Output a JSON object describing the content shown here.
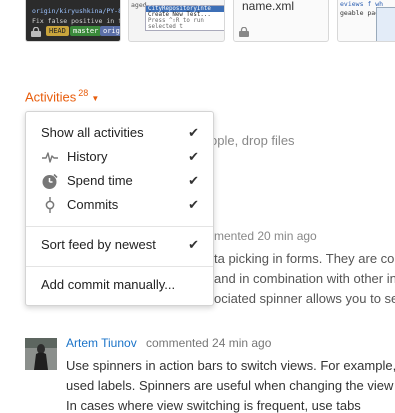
{
  "thumbnails": [
    {
      "lines": [
        "origin/kiryushkina/PY-8",
        "Fix false positive in format h"
      ],
      "branches": [
        "HEAD",
        "master",
        "origin"
      ]
    },
    {
      "lines": [
        "aged",
        "CityRepositoryInte",
        "Create New Test...",
        "Press ^⇧R to run selected t"
      ]
    },
    {
      "filename": "name.xml"
    },
    {
      "lines": [
        "eviews f wh",
        "geable page"
      ]
    }
  ],
  "activities": {
    "label": "Activities",
    "count": "28"
  },
  "menu": {
    "show_all": "Show all activities",
    "history": "History",
    "spend_time": "Spend time",
    "commits": "Commits",
    "sort": "Sort feed by newest",
    "add_commit": "Add commit manually...",
    "check_mark": "✔"
  },
  "background": {
    "drop_text": "ople, drop files",
    "event_meta": "mented 20 min ago",
    "line1": "ta picking in forms. They are co",
    "line2": "and in combination with other in",
    "line3": "ociated spinner allows you to se"
  },
  "comment": {
    "author": "Artem Tiunov",
    "meta": "commented 24 min ago",
    "line1": "Use spinners in action bars to switch views. For example,",
    "line2": "used labels. Spinners are useful when changing the view",
    "line3": "In cases where view switching is frequent, use tabs"
  },
  "colors": {
    "accent": "#e85d0c",
    "link": "#1a73c8"
  }
}
